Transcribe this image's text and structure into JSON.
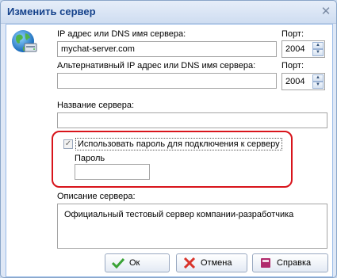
{
  "window": {
    "title": "Изменить сервер"
  },
  "form": {
    "ip_label": "IP адрес или DNS имя сервера:",
    "ip_value": "mychat-server.com",
    "port_label": "Порт:",
    "port_value": "2004",
    "alt_ip_label": "Альтернативный IP адрес или DNS имя сервера:",
    "alt_ip_value": "",
    "alt_port_label": "Порт:",
    "alt_port_value": "2004",
    "server_name_label": "Название сервера:",
    "server_name_value": "",
    "use_password_label": "Использовать пароль для подключения к серверу",
    "use_password_checked": true,
    "password_label": "Пароль",
    "password_value": "",
    "description_label": "Описание сервера:",
    "description_value": "Официальный тестовый сервер компании-разработчика"
  },
  "buttons": {
    "ok": "Ок",
    "cancel": "Отмена",
    "help": "Справка"
  },
  "icons": {
    "server": "globe-server-icon",
    "ok": "checkmark-icon",
    "cancel": "cross-icon",
    "help": "book-icon",
    "close": "close-icon"
  },
  "colors": {
    "title": "#15428b",
    "highlight": "#d8141b",
    "window_bg": "#dfe8f6"
  }
}
